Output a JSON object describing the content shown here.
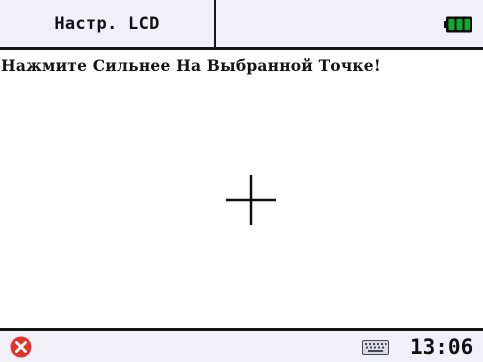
{
  "titlebar": {
    "tab_label": "Настр. LCD",
    "battery_icon": "battery-full-icon",
    "battery_color": "#12aa2c"
  },
  "content": {
    "instruction": "Нажмите Сильнее На Выбранной Точке!",
    "target_icon": "crosshair-icon"
  },
  "taskbar": {
    "close_icon": "close-icon",
    "close_color": "#e0342c",
    "keyboard_icon": "keyboard-icon",
    "time": "13:06"
  }
}
